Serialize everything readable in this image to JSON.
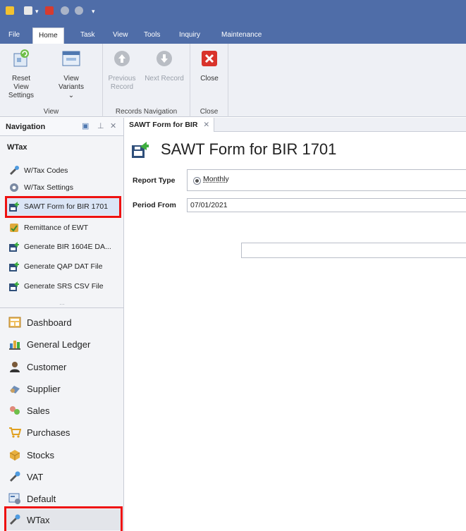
{
  "ribbon_tabs": [
    "File",
    "Home",
    "Task",
    "View",
    "Tools",
    "Inquiry",
    "Maintenance"
  ],
  "active_tab": "Home",
  "ribbon": {
    "view_group": {
      "label": "View",
      "reset_view_settings": "Reset View Settings",
      "view_variants": "View Variants"
    },
    "records_group": {
      "label": "Records Navigation",
      "previous_record": "Previous Record",
      "next_record": "Next Record"
    },
    "close_group": {
      "label": "Close",
      "close": "Close"
    }
  },
  "navigation": {
    "title": "Navigation",
    "section": "WTax",
    "items": [
      {
        "label": "W/Tax Codes",
        "icon": "wtax-codes-icon"
      },
      {
        "label": "W/Tax Settings",
        "icon": "settings-icon"
      },
      {
        "label": "SAWT Form for BIR 1701",
        "icon": "form-export-icon",
        "selected": true
      },
      {
        "label": "Remittance of EWT",
        "icon": "remittance-icon"
      },
      {
        "label": "Generate BIR 1604E DA...",
        "icon": "form-export-icon"
      },
      {
        "label": "Generate QAP DAT File",
        "icon": "form-export-icon"
      },
      {
        "label": "Generate SRS CSV File",
        "icon": "form-export-icon"
      }
    ],
    "more": "...",
    "modules": [
      {
        "label": "Dashboard",
        "icon": "dashboard-icon"
      },
      {
        "label": "General Ledger",
        "icon": "ledger-icon"
      },
      {
        "label": "Customer",
        "icon": "customer-icon"
      },
      {
        "label": "Supplier",
        "icon": "supplier-icon"
      },
      {
        "label": "Sales",
        "icon": "sales-icon"
      },
      {
        "label": "Purchases",
        "icon": "purchases-icon"
      },
      {
        "label": "Stocks",
        "icon": "stocks-icon"
      },
      {
        "label": "VAT",
        "icon": "vat-icon"
      },
      {
        "label": "Default",
        "icon": "default-icon"
      },
      {
        "label": "WTax",
        "icon": "wtax-icon",
        "active": true
      }
    ]
  },
  "document": {
    "tab_label": "SAWT Form for BIR",
    "title": "SAWT Form for BIR 1701",
    "report_type_label": "Report Type",
    "report_type_value": "Monthly",
    "period_from_label": "Period From",
    "period_from_value": "07/01/2021"
  },
  "colors": {
    "title_bar": "#4f6da8",
    "highlight": "#ee1111",
    "selected_item": "#dbe5f6"
  }
}
